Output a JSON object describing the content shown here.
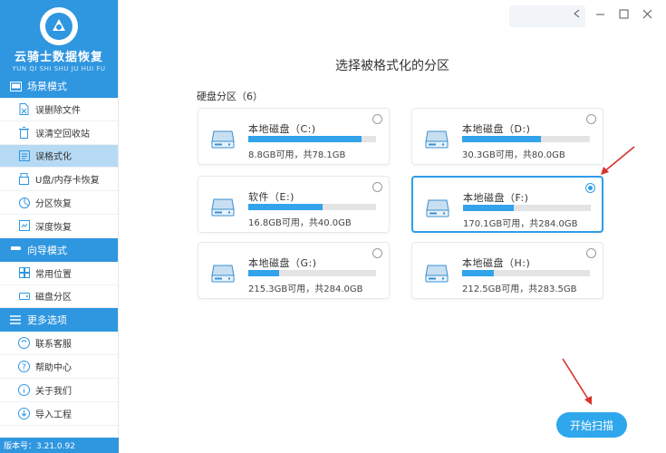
{
  "app": {
    "title": "云骑士数据恢复",
    "subtitle": "YUN QI SHI SHU JU HUI FU",
    "version": "版本号：3.21.0.92"
  },
  "sidebar": {
    "sections": [
      {
        "title": "场景模式",
        "icon": "scene-icon",
        "items": [
          {
            "label": "误删除文件",
            "icon": "delete-file-icon",
            "active": false
          },
          {
            "label": "误清空回收站",
            "icon": "recycle-bin-icon",
            "active": false
          },
          {
            "label": "误格式化",
            "icon": "format-icon",
            "active": true
          },
          {
            "label": "U盘/内存卡恢复",
            "icon": "usb-icon",
            "active": false
          },
          {
            "label": "分区恢复",
            "icon": "partition-icon",
            "active": false
          },
          {
            "label": "深度恢复",
            "icon": "deep-scan-icon",
            "active": false
          }
        ]
      },
      {
        "title": "向导模式",
        "icon": "wizard-icon",
        "items": [
          {
            "label": "常用位置",
            "icon": "common-location-icon",
            "active": false
          },
          {
            "label": "磁盘分区",
            "icon": "disk-partition-icon",
            "active": false
          }
        ]
      },
      {
        "title": "更多选项",
        "icon": "menu-icon",
        "items": [
          {
            "label": "联系客服",
            "icon": "customer-service-icon",
            "active": false
          },
          {
            "label": "帮助中心",
            "icon": "help-icon",
            "active": false
          },
          {
            "label": "关于我们",
            "icon": "info-icon",
            "active": false
          },
          {
            "label": "导入工程",
            "icon": "import-icon",
            "active": false
          }
        ]
      }
    ]
  },
  "main": {
    "title": "选择被格式化的分区",
    "group_label": "硬盘分区（6）",
    "partitions": [
      {
        "name": "本地磁盘（C:)",
        "info": "8.8GB可用，共78.1GB",
        "used_fraction": 0.887,
        "selected": false
      },
      {
        "name": "本地磁盘（D:)",
        "info": "30.3GB可用，共80.0GB",
        "used_fraction": 0.62,
        "selected": false
      },
      {
        "name": "软件（E:)",
        "info": "16.8GB可用，共40.0GB",
        "used_fraction": 0.58,
        "selected": false
      },
      {
        "name": "本地磁盘（F:)",
        "info": "170.1GB可用，共284.0GB",
        "used_fraction": 0.4,
        "selected": true
      },
      {
        "name": "本地磁盘（G:)",
        "info": "215.3GB可用，共284.0GB",
        "used_fraction": 0.24,
        "selected": false
      },
      {
        "name": "本地磁盘（H:)",
        "info": "212.5GB可用，共283.5GB",
        "used_fraction": 0.25,
        "selected": false
      }
    ],
    "start_button": "开始扫描"
  },
  "colors": {
    "brand": "#2f96e0",
    "active_item": "#b6daf3",
    "usage_bar": "#33a3ec",
    "annotation_arrow": "#d9312b"
  }
}
